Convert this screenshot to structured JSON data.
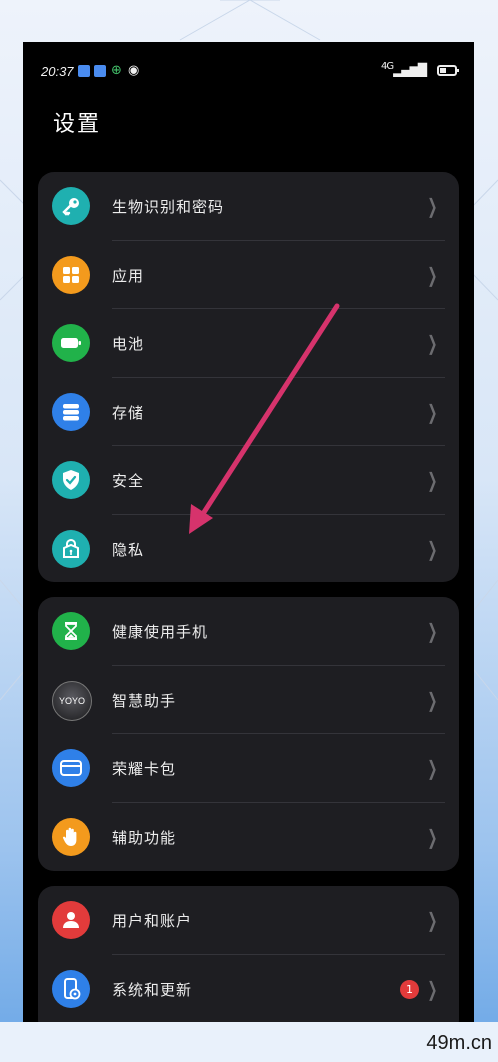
{
  "status_bar": {
    "time": "20:37",
    "network": "4G",
    "icons": [
      "mail-icon",
      "mail-icon",
      "globe-icon",
      "location-icon",
      "signal-icon",
      "battery-icon"
    ]
  },
  "page_title": "设置",
  "groups": [
    {
      "items": [
        {
          "label": "生物识别和密码",
          "icon": "key-icon",
          "color": "#1fb0b0"
        },
        {
          "label": "应用",
          "icon": "apps-grid-icon",
          "color": "#f39a1d"
        },
        {
          "label": "电池",
          "icon": "battery-icon",
          "color": "#21b24a"
        },
        {
          "label": "存储",
          "icon": "storage-icon",
          "color": "#2f80e8"
        },
        {
          "label": "安全",
          "icon": "shield-check-icon",
          "color": "#1fb0b0"
        },
        {
          "label": "隐私",
          "icon": "privacy-lock-icon",
          "color": "#1fb0b0"
        }
      ]
    },
    {
      "items": [
        {
          "label": "健康使用手机",
          "icon": "hourglass-icon",
          "color": "#21b24a"
        },
        {
          "label": "智慧助手",
          "icon": "yoyo-icon",
          "color": "#2a2a2e",
          "icon_text": "YOYO"
        },
        {
          "label": "荣耀卡包",
          "icon": "wallet-card-icon",
          "color": "#2f80e8"
        },
        {
          "label": "辅助功能",
          "icon": "hand-icon",
          "color": "#f39a1d"
        }
      ]
    },
    {
      "items": [
        {
          "label": "用户和账户",
          "icon": "user-icon",
          "color": "#e23b3b"
        },
        {
          "label": "系统和更新",
          "icon": "phone-settings-icon",
          "color": "#2f80e8",
          "badge": "1"
        }
      ]
    }
  ],
  "annotation": {
    "arrow_color": "#d6336c"
  },
  "watermark": "49m.cn"
}
